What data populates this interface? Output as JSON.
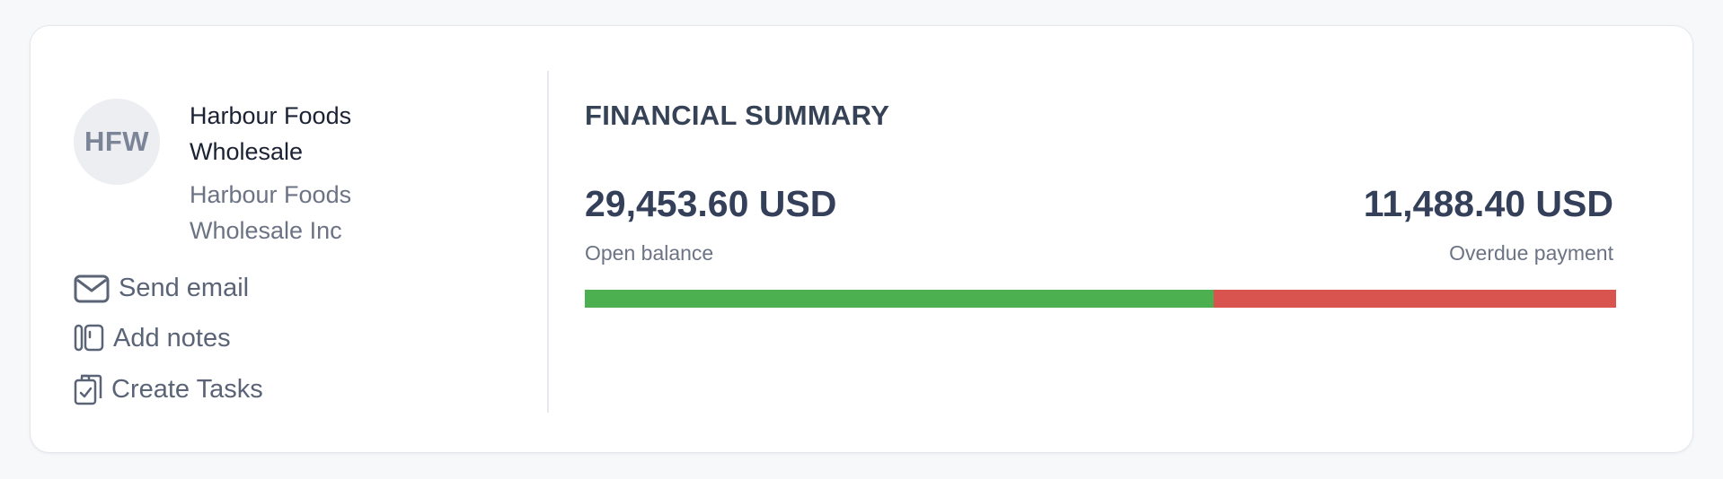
{
  "customer": {
    "initials": "HFW",
    "name": "Harbour Foods Wholesale",
    "legal_name": "Harbour Foods Wholesale Inc"
  },
  "actions": [
    {
      "label": "Send email",
      "icon": "mail-icon"
    },
    {
      "label": "Add notes",
      "icon": "notes-icon"
    },
    {
      "label": "Create Tasks",
      "icon": "clipboard-check-icon"
    }
  ],
  "financial_summary": {
    "title": "FINANCIAL SUMMARY",
    "open_balance": {
      "amount": "29,453.60 USD",
      "label": "Open balance"
    },
    "overdue_payment": {
      "amount": "11,488.40 USD",
      "label": "Overdue payment"
    },
    "bar": {
      "open_fraction": 0.61,
      "overdue_fraction": 0.39,
      "open_color": "#4caf50",
      "overdue_color": "#d9534f"
    }
  }
}
